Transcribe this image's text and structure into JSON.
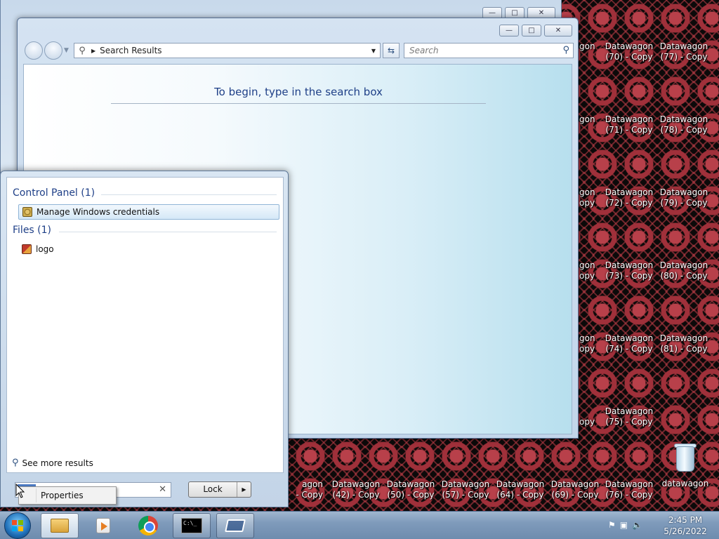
{
  "desktop": {
    "icons_col1": [
      {
        "line1": "Datawagon",
        "line2": "(70) - Copy"
      },
      {
        "line1": "Datawagon",
        "line2": "(71) - Copy"
      },
      {
        "line1": "Datawagon",
        "line2": "(72) - Copy"
      },
      {
        "line1": "Datawagon",
        "line2": "(73) - Copy"
      },
      {
        "line1": "Datawagon",
        "line2": "(74) - Copy"
      },
      {
        "line1": "Datawagon",
        "line2": "(75) - Copy"
      },
      {
        "line1": "Datawagon",
        "line2": "(76) - Copy"
      }
    ],
    "icons_col2": [
      {
        "line1": "Datawagon",
        "line2": "(77) - Copy"
      },
      {
        "line1": "Datawagon",
        "line2": "(78) - Copy"
      },
      {
        "line1": "Datawagon",
        "line2": "(79) - Copy"
      },
      {
        "line1": "Datawagon",
        "line2": "(80) - Copy"
      },
      {
        "line1": "Datawagon",
        "line2": "(81) - Copy"
      }
    ],
    "partial_col": [
      {
        "line1": "gon",
        "line2": "opy"
      },
      {
        "line1": "gon",
        "line2": "opy"
      },
      {
        "line1": "gon",
        "line2": "opy"
      },
      {
        "line1": "gon",
        "line2": "opy"
      },
      {
        "line1": "gon",
        "line2": "opy"
      }
    ],
    "bottom_row": [
      {
        "line1": "agon",
        "line2": "- Copy"
      },
      {
        "line1": "Datawagon",
        "line2": "(42) - Copy"
      },
      {
        "line1": "Datawagon",
        "line2": "(50) - Copy"
      },
      {
        "line1": "Datawagon",
        "line2": "(57) - Copy"
      },
      {
        "line1": "Datawagon",
        "line2": "(64) - Copy"
      },
      {
        "line1": "Datawagon",
        "line2": "(69) - Copy"
      }
    ],
    "recycle_label": "datawagon"
  },
  "explorer": {
    "address": "Search Results",
    "search_placeholder": "Search",
    "hint": "To begin, type in the search box"
  },
  "start_menu": {
    "group1_header": "Control Panel (1)",
    "group1_item": "Manage Windows credentials",
    "group2_header": "Files (1)",
    "group2_item": "logo",
    "see_more": "See more results",
    "lock_label": "Lock"
  },
  "context_menu": {
    "item": "Properties"
  },
  "taskbar": {
    "time": "2:45 PM",
    "date": "5/26/2022"
  },
  "icons": {
    "start": "windows-orb-icon",
    "explorer": "folder-icon",
    "media": "media-player-icon",
    "browser": "chrome-icon",
    "cmd": "command-prompt-icon",
    "rdp": "remote-desktop-icon"
  }
}
